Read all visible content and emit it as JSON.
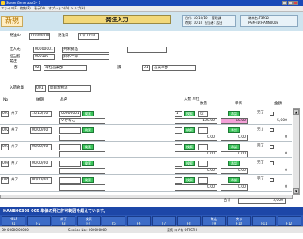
{
  "window": {
    "title": "ScreenGenerator5 - 1"
  },
  "menu": [
    "ファイル(F)",
    "編集(E)",
    "表示(V)",
    "オプション(O)",
    "ヘルプ(H)"
  ],
  "header": {
    "mode_tab": "新規",
    "screen_title": "発注入力",
    "info_left": {
      "date_label": "日付",
      "date": "10/10/10",
      "system": "管理課",
      "time_label": "時刻",
      "time": "10:10",
      "user_label": "担当者",
      "user": "広田"
    },
    "info_right": {
      "line1": "端末名:T3910",
      "line2": "PGM-ID:HANN0008"
    }
  },
  "form": {
    "order_no": {
      "label": "発注No",
      "value": "00000000"
    },
    "order_date": {
      "label": "発注日",
      "value": "10/10/10"
    },
    "supplier": {
      "label": "仕入先",
      "code": "00000001",
      "name": "共栄食品"
    },
    "person": {
      "label": "担当者",
      "code": "000100",
      "name": "鈴木一郎"
    },
    "dest_label": "発注",
    "dept": {
      "label": "部",
      "code": "02",
      "name": "本社営業部"
    },
    "section": {
      "label": "課",
      "code": "01",
      "name": "営業本部"
    },
    "warehouse": {
      "label": "入荷倉庫",
      "code": "001",
      "name": "関目本物流"
    }
  },
  "grid_headers": {
    "row_no": "No",
    "due": "納期",
    "product": "品名",
    "qty": "入数 単位",
    "qty2": "数量",
    "price": "単価",
    "amount": "金額"
  },
  "rows": [
    {
      "no": "001",
      "kind": "州ア",
      "date": "10/10/10",
      "code": "00000001",
      "search": "検索",
      "pname": "いかなご",
      "case": "1",
      "case_search": "検索",
      "unit": "匹",
      "qty": "100.00",
      "unit_btn": "承認",
      "price": "50.00",
      "done": "完了",
      "amount": "5,000"
    },
    {
      "no": "002",
      "kind": "州ア",
      "date": "00/00/00",
      "code": "",
      "search": "検索",
      "pname": "",
      "case": "",
      "case_search": "検索",
      "unit": "",
      "qty": "0.00",
      "unit_btn": "承認",
      "price": "0.00",
      "done": "完了",
      "amount": "0"
    },
    {
      "no": "003",
      "kind": "州ア",
      "date": "00/00/00",
      "code": "",
      "search": "検索",
      "pname": "",
      "case": "",
      "case_search": "検索",
      "unit": "",
      "qty": "0.00",
      "unit_btn": "承認",
      "price": "0.00",
      "done": "完了",
      "amount": "0"
    },
    {
      "no": "004",
      "kind": "州ア",
      "date": "00/00/00",
      "code": "",
      "search": "検索",
      "pname": "",
      "case": "",
      "case_search": "検索",
      "unit": "",
      "qty": "0.00",
      "unit_btn": "承認",
      "price": "0.00",
      "done": "完了",
      "amount": "0"
    },
    {
      "no": "005",
      "kind": "州ア",
      "date": "00/00/00",
      "code": "",
      "search": "検索",
      "pname": "",
      "case": "",
      "case_search": "検索",
      "unit": "",
      "qty": "0.00",
      "unit_btn": "承認",
      "price": "0.00",
      "done": "完了",
      "amount": "0"
    }
  ],
  "total": {
    "label": "合計",
    "value": "5,000"
  },
  "status_message": "HANB0030E 005 単価の発注許可範囲を超えています。",
  "fkeys": [
    {
      "top": "HELP",
      "bottom": "F1"
    },
    {
      "top": "",
      "bottom": "F2"
    },
    {
      "top": "終了",
      "bottom": "F3"
    },
    {
      "top": "検索",
      "bottom": "F4"
    },
    {
      "top": "",
      "bottom": "F5"
    },
    {
      "top": "",
      "bottom": "F6"
    },
    {
      "top": "",
      "bottom": "F7"
    },
    {
      "top": "",
      "bottom": "F8"
    },
    {
      "top": "確定",
      "bottom": "F9"
    },
    {
      "top": "戻る",
      "bottom": "F10"
    },
    {
      "top": "",
      "bottom": "F11"
    },
    {
      "top": "",
      "bottom": "F12"
    }
  ],
  "statusbar": {
    "left": "OK   00000/00000",
    "session": "Session No : 000000009",
    "right": "接続  ログ有   OFFSTH"
  }
}
